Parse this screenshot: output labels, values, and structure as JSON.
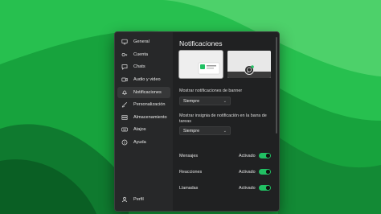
{
  "sidebar": {
    "items": [
      {
        "label": "General",
        "icon": "monitor-icon"
      },
      {
        "label": "Cuenta",
        "icon": "key-icon"
      },
      {
        "label": "Chats",
        "icon": "chat-icon"
      },
      {
        "label": "Audio y video",
        "icon": "video-icon"
      },
      {
        "label": "Notificaciones",
        "icon": "bell-icon",
        "active": true
      },
      {
        "label": "Personalización",
        "icon": "brush-icon"
      },
      {
        "label": "Almacenamiento",
        "icon": "storage-icon"
      },
      {
        "label": "Atajos",
        "icon": "keyboard-icon"
      },
      {
        "label": "Ayuda",
        "icon": "info-icon"
      }
    ],
    "profile_label": "Perfil"
  },
  "content": {
    "title": "Notificaciones",
    "banner_label": "Mostrar notificaciones de banner",
    "banner_value": "Siempre",
    "taskbar_label": "Mostrar insignia de notificación en la barra de tareas",
    "taskbar_value": "Siempre",
    "toggles": [
      {
        "label": "Mensajes",
        "status": "Activado",
        "on": true
      },
      {
        "label": "Reacciones",
        "status": "Activado",
        "on": true
      },
      {
        "label": "Llamadas",
        "status": "Activado",
        "on": true
      }
    ]
  },
  "colors": {
    "accent": "#21c063",
    "window": "#202122",
    "sidebar": "#272829"
  }
}
